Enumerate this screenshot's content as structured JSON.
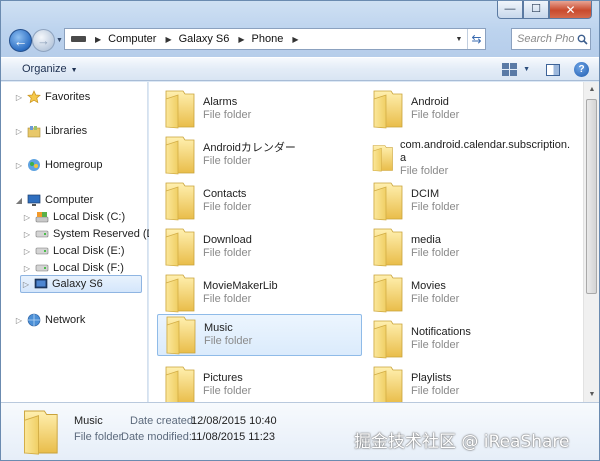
{
  "window": {
    "controls": {
      "minimize": "—",
      "maximize": "☐",
      "close": "✕"
    }
  },
  "address": {
    "crumbs": [
      "Computer",
      "Galaxy S6",
      "Phone"
    ]
  },
  "search": {
    "placeholder": "Search Pho..."
  },
  "toolbar": {
    "organize_label": "Organize"
  },
  "nav": {
    "favorites": "Favorites",
    "libraries": "Libraries",
    "homegroup": "Homegroup",
    "computer": "Computer",
    "local_c": "Local Disk (C:)",
    "system_reserved": "System Reserved (D:)",
    "local_e": "Local Disk (E:)",
    "local_f": "Local Disk (F:)",
    "galaxy": "Galaxy S6",
    "network": "Network"
  },
  "folders": [
    {
      "name": "Alarms",
      "type": "File folder"
    },
    {
      "name": "Android",
      "type": "File folder"
    },
    {
      "name": "Androidカレンダー",
      "type": "File folder"
    },
    {
      "name": "com.android.calendar.subscription.",
      "name2": "a",
      "type": "File folder"
    },
    {
      "name": "Contacts",
      "type": "File folder"
    },
    {
      "name": "DCIM",
      "type": "File folder"
    },
    {
      "name": "Download",
      "type": "File folder"
    },
    {
      "name": "media",
      "type": "File folder"
    },
    {
      "name": "MovieMakerLib",
      "type": "File folder"
    },
    {
      "name": "Movies",
      "type": "File folder"
    },
    {
      "name": "Music",
      "type": "File folder"
    },
    {
      "name": "Notifications",
      "type": "File folder"
    },
    {
      "name": "Pictures",
      "type": "File folder"
    },
    {
      "name": "Playlists",
      "type": "File folder"
    }
  ],
  "details": {
    "name": "Music",
    "type": "File folder",
    "created_label": "Date created:",
    "created_value": "12/08/2015 10:40",
    "modified_label": "Date modified:",
    "modified_value": "11/08/2015 11:23"
  },
  "watermark": "掘金技术社区 @ iReaShare",
  "colors": {
    "accent": "#3a6bb0",
    "selection": "#dbebfc",
    "folder": "#f3d56a"
  }
}
